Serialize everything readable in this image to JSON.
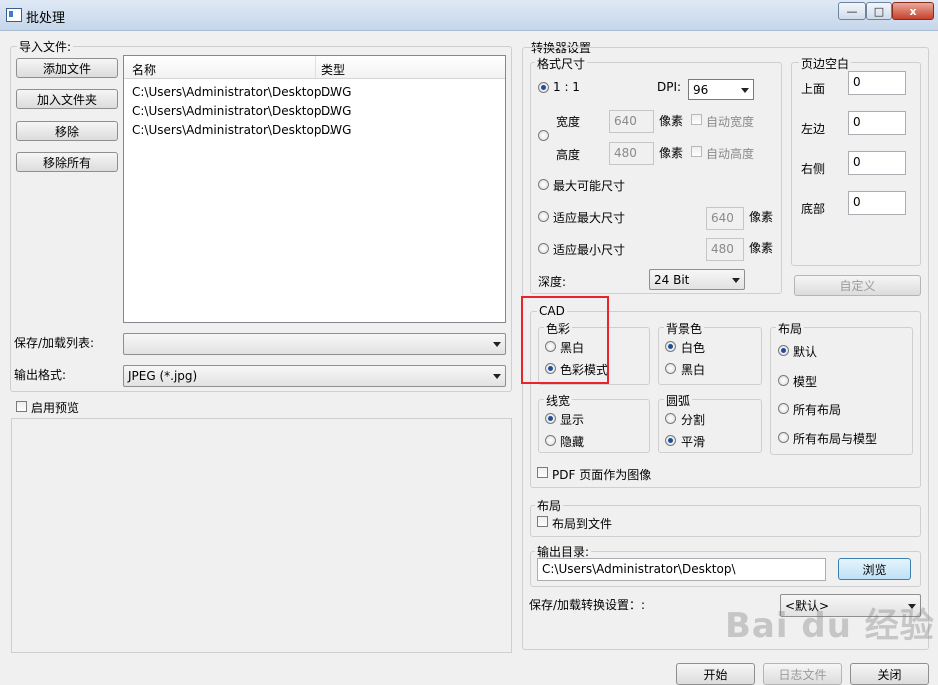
{
  "window": {
    "title": "批处理",
    "min_label": "—",
    "max_label": "□",
    "close_label": "x"
  },
  "import": {
    "label": "导入文件:",
    "buttons": {
      "add_file": "添加文件",
      "add_folder": "加入文件夹",
      "remove": "移除",
      "remove_all": "移除所有"
    },
    "columns": {
      "name": "名称",
      "type": "类型"
    },
    "rows": [
      {
        "name": "C:\\Users\\Administrator\\Desktop...",
        "type": "DWG"
      },
      {
        "name": "C:\\Users\\Administrator\\Desktop...",
        "type": "DWG"
      },
      {
        "name": "C:\\Users\\Administrator\\Desktop...",
        "type": "DWG"
      }
    ]
  },
  "left_settings": {
    "save_load_list_label": "保存/加载列表:",
    "save_load_list_value": "",
    "output_format_label": "输出格式:",
    "output_format_value": "JPEG (*.jpg)",
    "enable_preview_label": "启用预览"
  },
  "converter": {
    "label": "转换器设置",
    "format_size": {
      "label": "格式尺寸",
      "ratio_label": "1 : 1",
      "dpi_label": "DPI:",
      "dpi_value": "96",
      "width_label": "宽度",
      "width_value": "640",
      "height_label": "高度",
      "height_value": "480",
      "pixels_label": "像素",
      "auto_width_label": "自动宽度",
      "auto_height_label": "自动高度",
      "max_possible_label": "最大可能尺寸",
      "fit_max_label": "适应最大尺寸",
      "fit_max_value": "640",
      "fit_min_label": "适应最小尺寸",
      "fit_min_value": "480",
      "depth_label": "深度:",
      "depth_value": "24 Bit"
    },
    "margins": {
      "label": "页边空白",
      "top_label": "上面",
      "top_value": "0",
      "left_label": "左边",
      "left_value": "0",
      "right_label": "右侧",
      "right_value": "0",
      "bottom_label": "底部",
      "bottom_value": "0",
      "custom_label": "自定义"
    },
    "cad": {
      "label": "CAD",
      "color": {
        "label": "色彩",
        "bw": "黑白",
        "color_mode": "色彩模式"
      },
      "background": {
        "label": "背景色",
        "white": "白色",
        "black": "黑白"
      },
      "layout": {
        "label": "布局",
        "default": "默认",
        "model": "模型",
        "all_layouts": "所有布局",
        "all_layouts_model": "所有布局与模型"
      },
      "line_width": {
        "label": "线宽",
        "show": "显示",
        "hide": "隐藏"
      },
      "arc": {
        "label": "圆弧",
        "split": "分割",
        "smooth": "平滑"
      },
      "pdf_page_label": "PDF 页面作为图像"
    },
    "layout_section": {
      "label": "布局",
      "layout_to_file": "布局到文件"
    },
    "output_dir": {
      "label": "输出目录:",
      "value": "C:\\Users\\Administrator\\Desktop\\",
      "browse": "浏览"
    },
    "save_load_convert_label": "保存/加载转换设置：:",
    "save_load_convert_value": "<默认>"
  },
  "footer": {
    "start": "开始",
    "log": "日志文件",
    "close": "关闭"
  },
  "watermark": "Bai du 经验"
}
